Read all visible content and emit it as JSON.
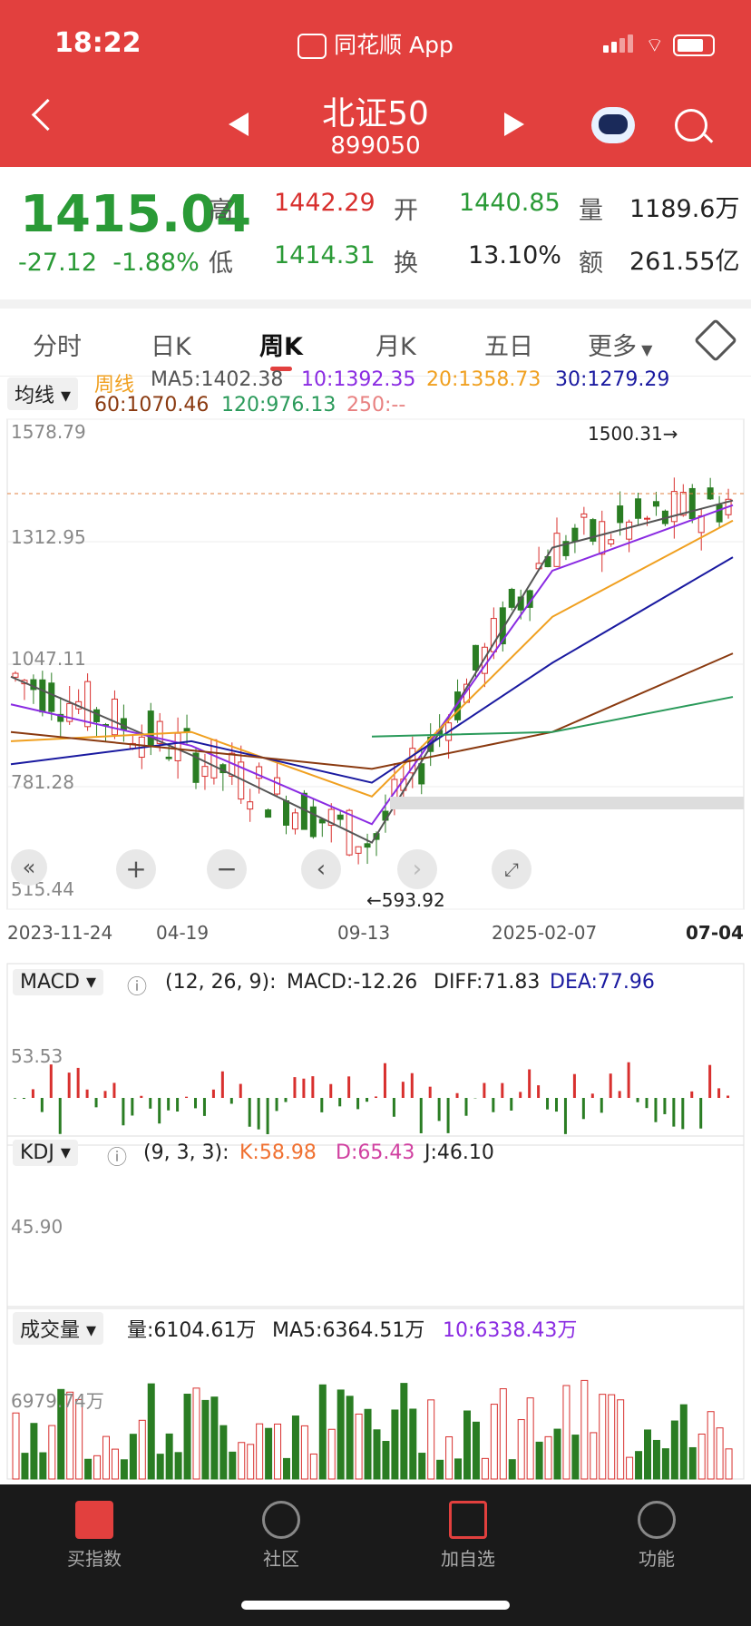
{
  "status": {
    "time": "18:22",
    "app": "同花顺 App"
  },
  "header": {
    "title": "北证50",
    "code": "899050"
  },
  "quote": {
    "price": "1415.04",
    "change": "-27.12",
    "change_pct": "-1.88%",
    "high_label": "高",
    "high": "1442.29",
    "low_label": "低",
    "low": "1414.31",
    "open_label": "开",
    "open": "1440.85",
    "turnover_label": "换",
    "turnover": "13.10%",
    "vol_label": "量",
    "vol": "1189.6万",
    "amount_label": "额",
    "amount": "261.55亿"
  },
  "tabs": [
    "分时",
    "日K",
    "周K",
    "月K",
    "五日",
    "更多"
  ],
  "ma_panel": {
    "selector": "均线",
    "period": "周线",
    "ma5": "MA5:1402.38",
    "ma10": "10:1392.35",
    "ma20": "20:1358.73",
    "ma30": "30:1279.29",
    "ma60": "60:1070.46",
    "ma120": "120:976.13",
    "ma250": "250:--",
    "y_ticks": [
      "1578.79",
      "1312.95",
      "1047.11",
      "781.28",
      "515.44"
    ],
    "high_marker": "1500.31→",
    "low_marker": "←593.92",
    "x_ticks": [
      "2023-11-24",
      "04-19",
      "09-13",
      "2025-02-07",
      "07-04"
    ]
  },
  "macd": {
    "selector": "MACD",
    "params": "(12, 26, 9):",
    "macd": "MACD:-12.26",
    "diff": "DIFF:71.83",
    "dea": "DEA:77.96",
    "axis": "53.53"
  },
  "kdj": {
    "selector": "KDJ",
    "params": "(9, 3, 3):",
    "k": "K:58.98",
    "d": "D:65.43",
    "j": "J:46.10",
    "axis": "45.90"
  },
  "volume": {
    "selector": "成交量",
    "vol": "量:6104.61万",
    "ma5": "MA5:6364.51万",
    "ma10": "10:6338.43万",
    "axis": "6979.74万"
  },
  "bottom_nav": [
    "买指数",
    "社区",
    "加自选",
    "功能"
  ],
  "colors": {
    "up": "#d8302e",
    "down": "#2a7d23",
    "header": "#e2403e",
    "ma5": "#555555",
    "ma10": "#8a2be2",
    "ma20": "#f0a020",
    "ma30": "#1a1aa0",
    "ma60": "#8a3a10",
    "ma120": "#2a9a5a"
  },
  "chart_data": {
    "type": "line",
    "title": "周K",
    "x": [
      "2023-11-24",
      "04-19",
      "09-13",
      "2025-02-07",
      "07-04"
    ],
    "series": [
      {
        "name": "MA5",
        "values": [
          1020,
          850,
          660,
          1300,
          1402.38
        ]
      },
      {
        "name": "MA10",
        "values": [
          960,
          870,
          700,
          1250,
          1392.35
        ]
      },
      {
        "name": "MA20",
        "values": [
          880,
          900,
          760,
          1150,
          1358.73
        ]
      },
      {
        "name": "MA30",
        "values": [
          830,
          880,
          790,
          1050,
          1279.29
        ]
      },
      {
        "name": "MA60",
        "values": [
          900,
          860,
          820,
          900,
          1070.46
        ]
      },
      {
        "name": "MA120",
        "values": [
          null,
          null,
          890,
          900,
          976.13
        ]
      }
    ],
    "ylim": [
      515.44,
      1578.79
    ]
  }
}
